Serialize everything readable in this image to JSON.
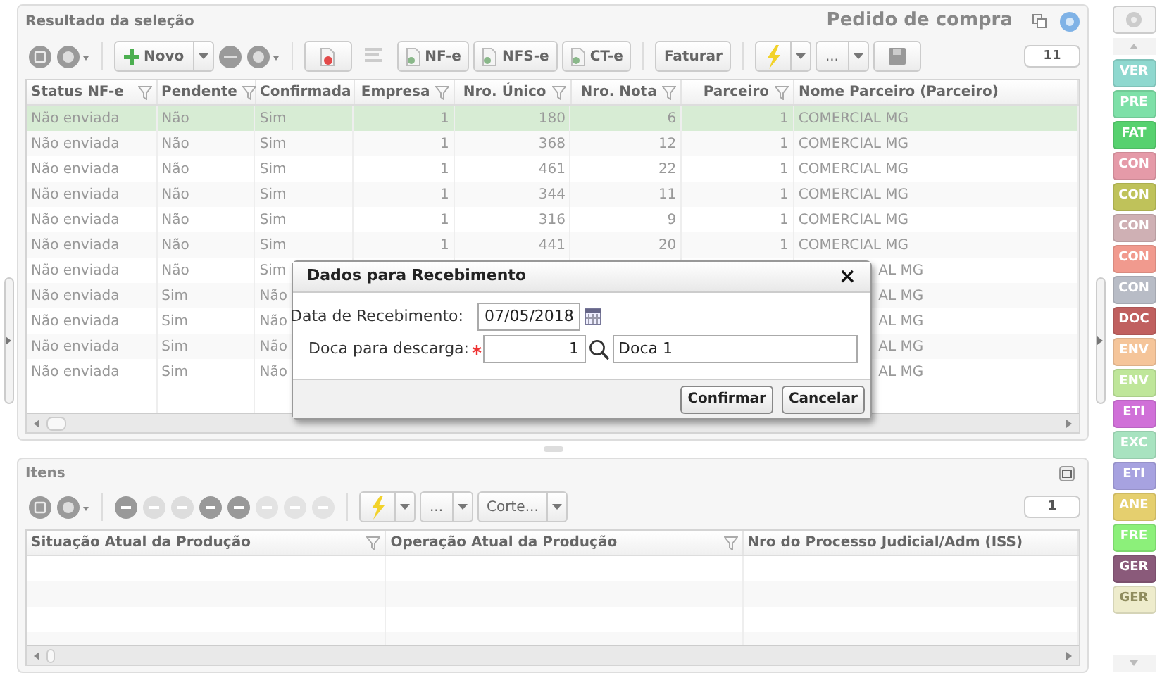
{
  "results_panel": {
    "title": "Resultado da seleção",
    "context_title": "Pedido de compra",
    "toolbar": {
      "new_label": "Novo",
      "doc_buttons": [
        "NF-e",
        "NFS-e",
        "CT-e"
      ],
      "invoice_label": "Faturar",
      "more_label": "...",
      "record_count": "11"
    },
    "columns": [
      {
        "label": "Status NF-e",
        "filter": true,
        "numeric": false
      },
      {
        "label": "Pendente",
        "filter": true,
        "numeric": false
      },
      {
        "label": "Confirmada",
        "filter": false,
        "numeric": false
      },
      {
        "label": "Empresa",
        "filter": true,
        "numeric": true
      },
      {
        "label": "Nro. Único",
        "filter": true,
        "numeric": true
      },
      {
        "label": "Nro. Nota",
        "filter": true,
        "numeric": true
      },
      {
        "label": "Parceiro",
        "filter": true,
        "numeric": true
      },
      {
        "label": "Nome Parceiro (Parceiro)",
        "filter": false,
        "numeric": false
      }
    ],
    "rows": [
      {
        "selected": true,
        "covered": false,
        "cells": [
          "Não enviada",
          "Não",
          "Sim",
          "1",
          "180",
          "6",
          "1",
          "COMERCIAL MG"
        ]
      },
      {
        "selected": false,
        "covered": false,
        "cells": [
          "Não enviada",
          "Não",
          "Sim",
          "1",
          "368",
          "12",
          "1",
          "COMERCIAL MG"
        ]
      },
      {
        "selected": false,
        "covered": false,
        "cells": [
          "Não enviada",
          "Não",
          "Sim",
          "1",
          "461",
          "22",
          "1",
          "COMERCIAL MG"
        ]
      },
      {
        "selected": false,
        "covered": false,
        "cells": [
          "Não enviada",
          "Não",
          "Sim",
          "1",
          "344",
          "11",
          "1",
          "COMERCIAL MG"
        ]
      },
      {
        "selected": false,
        "covered": false,
        "cells": [
          "Não enviada",
          "Não",
          "Sim",
          "1",
          "316",
          "9",
          "1",
          "COMERCIAL MG"
        ]
      },
      {
        "selected": false,
        "covered": false,
        "cells": [
          "Não enviada",
          "Não",
          "Sim",
          "1",
          "441",
          "20",
          "1",
          "COMERCIAL MG"
        ]
      },
      {
        "selected": false,
        "covered": true,
        "cells": [
          "Não enviada",
          "Não",
          "Sim"
        ],
        "visible_tail": "AL MG"
      },
      {
        "selected": false,
        "covered": true,
        "cells": [
          "Não enviada",
          "Sim",
          "Não"
        ],
        "visible_tail": "AL MG"
      },
      {
        "selected": false,
        "covered": true,
        "cells": [
          "Não enviada",
          "Sim",
          "Não"
        ],
        "visible_tail": "AL MG"
      },
      {
        "selected": false,
        "covered": true,
        "cells": [
          "Não enviada",
          "Sim",
          "Não"
        ],
        "visible_tail": "AL MG"
      },
      {
        "selected": false,
        "covered": true,
        "cells": [
          "Não enviada",
          "Sim",
          "Não"
        ],
        "visible_tail": "AL MG"
      }
    ]
  },
  "items_panel": {
    "title": "Itens",
    "toolbar": {
      "more_label": "...",
      "cut_label": "Corte...",
      "record_count": "1"
    },
    "columns": [
      {
        "label": "Situação Atual da Produção",
        "filter": true
      },
      {
        "label": "Operação Atual da Produção",
        "filter": true
      },
      {
        "label": "Nro do Processo Judicial/Adm (ISS)",
        "filter": false
      }
    ]
  },
  "dialog": {
    "title": "Dados para Recebimento",
    "close": "×",
    "fields": [
      {
        "kind": "date",
        "label": "Data de Recebimento:",
        "required": false,
        "value": "07/05/2018"
      },
      {
        "kind": "lookup",
        "label": "Doca para descarga:",
        "required": true,
        "value": "1",
        "description": "Doca 1"
      }
    ],
    "buttons": [
      "Confirmar",
      "Cancelar"
    ]
  },
  "sidebar": {
    "tags": [
      {
        "label": "VER",
        "color": "#8fd8cf"
      },
      {
        "label": "PRE",
        "color": "#7ee0a8"
      },
      {
        "label": "FAT",
        "color": "#57d16f"
      },
      {
        "label": "CON",
        "color": "#e59aa8"
      },
      {
        "label": "CON",
        "color": "#bfc25a"
      },
      {
        "label": "CON",
        "color": "#cfb0b4"
      },
      {
        "label": "CON",
        "color": "#f19a8e"
      },
      {
        "label": "CON",
        "color": "#b8bcc6"
      },
      {
        "label": "DOC",
        "color": "#c0605f"
      },
      {
        "label": "ENV",
        "color": "#f5c59a"
      },
      {
        "label": "ENV",
        "color": "#bfe69a"
      },
      {
        "label": "ETI",
        "color": "#d070d8"
      },
      {
        "label": "EXC",
        "color": "#a8e3c0"
      },
      {
        "label": "ETI",
        "color": "#a7a2e0"
      },
      {
        "label": "ANE",
        "color": "#e5cf6e"
      },
      {
        "label": "FRE",
        "color": "#8cf07a"
      },
      {
        "label": "GER",
        "color": "#8a5a7a"
      },
      {
        "label": "GER",
        "color": "#eeeccc"
      }
    ]
  }
}
